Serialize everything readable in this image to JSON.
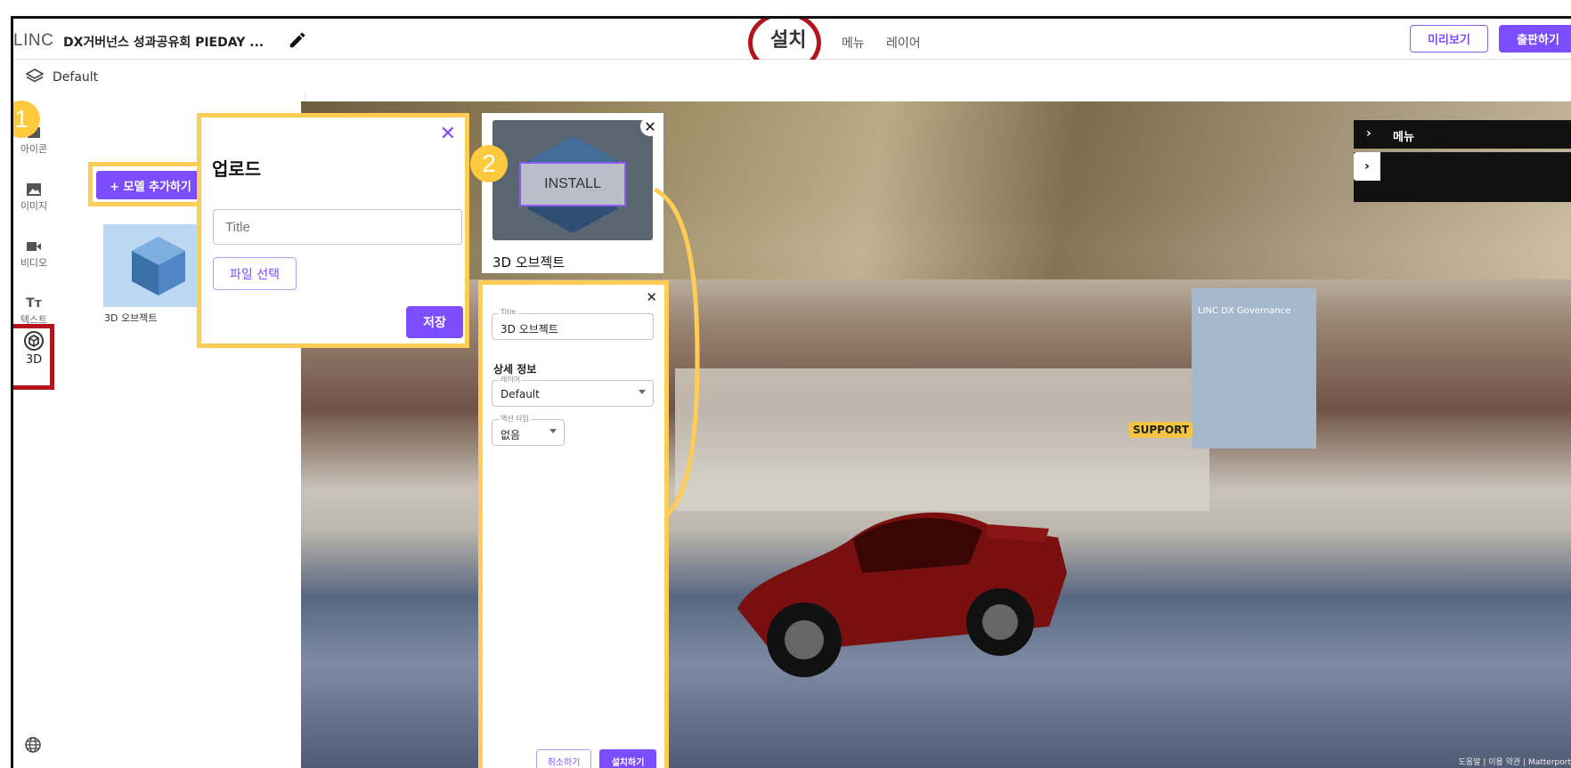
{
  "header": {
    "logo": "LINC",
    "project_title": "DX거버넌스 성과공유회 PIEDAY ...",
    "tabs": [
      {
        "label": "설치",
        "active": true
      },
      {
        "label": "메뉴",
        "active": false
      },
      {
        "label": "레이어",
        "active": false
      }
    ],
    "preview_label": "미리보기",
    "publish_label": "출판하기"
  },
  "layerbar": {
    "current_layer": "Default"
  },
  "rail": {
    "items": [
      {
        "label": "아이콘",
        "icon": "icon-icon"
      },
      {
        "label": "이미지",
        "icon": "image-icon"
      },
      {
        "label": "비디오",
        "icon": "video-icon"
      },
      {
        "label": "텍스트",
        "icon": "text-icon"
      },
      {
        "label": "3D",
        "icon": "cube-3d-icon",
        "active": true
      }
    ]
  },
  "panel": {
    "add_model_label": "+ 모델 추가하기",
    "model_thumb_label": "3D 오브젝트"
  },
  "upload": {
    "heading": "업로드",
    "title_placeholder": "Title",
    "file_select_label": "파일 선택",
    "save_label": "저장"
  },
  "install_card": {
    "hover_label": "INSTALL",
    "label": "3D 오브젝트"
  },
  "detail": {
    "title_label": "Title",
    "title_value": "3D 오브젝트",
    "section": "상세 정보",
    "layer_label": "레이어",
    "layer_value": "Default",
    "action_label": "액션 타입",
    "action_value": "없음",
    "cancel_label": "취소하기",
    "install_label": "설치하기"
  },
  "viewport": {
    "menu_label": "메뉴",
    "screen_text": "LINC DX Governance",
    "support_label": "SUPPORT",
    "footer_text": "도움말 | 이용 약관 | Matterport"
  },
  "annotations": {
    "badge_1": "1",
    "badge_2": "2"
  },
  "colors": {
    "accent": "#7c4dff",
    "highlight": "#ffcc55",
    "callout": "#b3141c"
  }
}
